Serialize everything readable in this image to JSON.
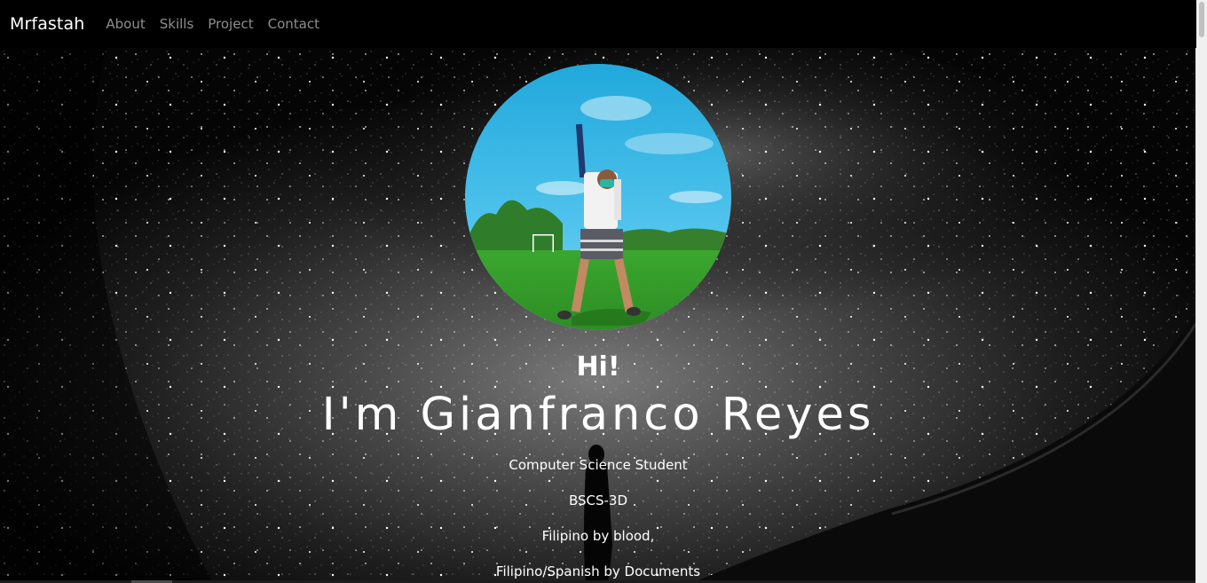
{
  "navbar": {
    "brand": "Mrfastah",
    "links": [
      "About",
      "Skills",
      "Project",
      "Contact"
    ]
  },
  "hero": {
    "greeting": "Hi!",
    "headline": "I'm Gianfranco Reyes",
    "lines": [
      "Computer Science Student",
      "BSCS-3D",
      "Filipino by blood,",
      "Filipino/Spanish by Documents"
    ]
  },
  "colors": {
    "nav_bg": "#000000",
    "nav_link": "#8c8c8c",
    "text": "#ffffff",
    "sky": "#2fb3e3",
    "grass": "#3fae35"
  },
  "icons": {
    "background": "starfield-image",
    "avatar": "profile-photo"
  }
}
